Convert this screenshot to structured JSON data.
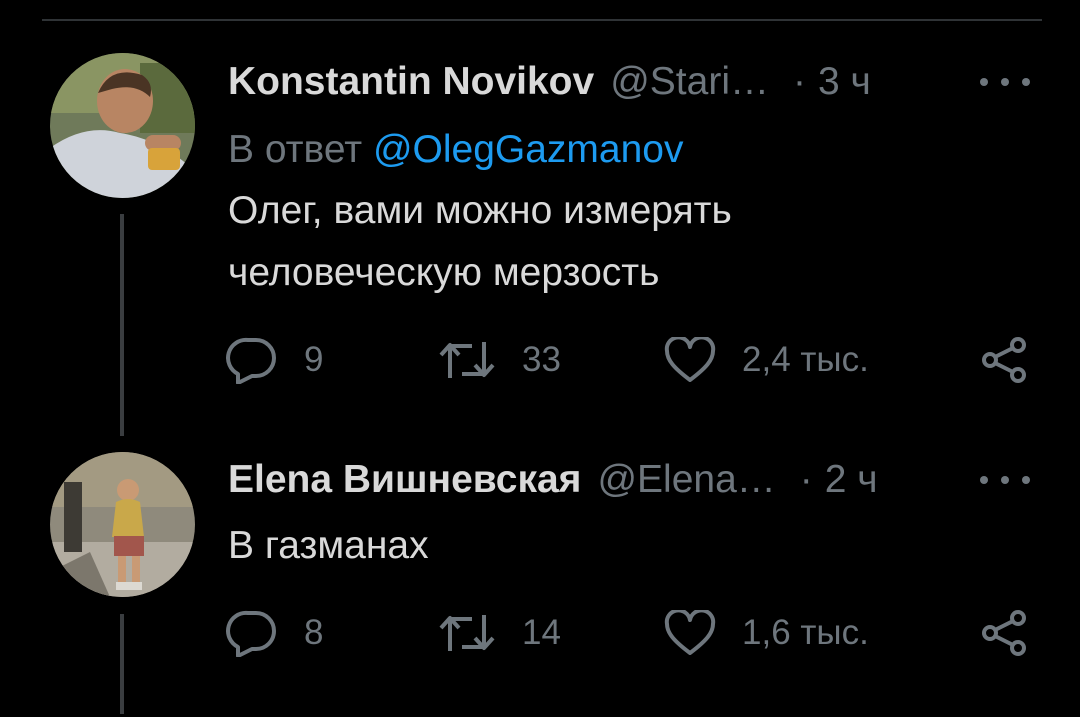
{
  "tweets": [
    {
      "author_name": "Konstantin Novikov",
      "handle": "@Stari…",
      "separator": "·",
      "time": "3 ч",
      "reply_prefix": "В ответ",
      "reply_mention": "@OlegGazmanov",
      "text": "Олег, вами можно измерять\nчеловеческую мерзость",
      "replies": "9",
      "retweets": "33",
      "likes": "2,4 тыс."
    },
    {
      "author_name": "Elena Вишневская",
      "handle": "@Elena…",
      "separator": "·",
      "time": "2 ч",
      "text": "В газманах",
      "replies": "8",
      "retweets": "14",
      "likes": "1,6 тыс."
    }
  ],
  "colors": {
    "background": "#000000",
    "primary_text": "#d9d9d9",
    "secondary_text": "#6e767d",
    "accent": "#1d9bf0"
  },
  "icons": [
    "reply-icon",
    "retweet-icon",
    "like-icon",
    "share-icon",
    "more-icon"
  ]
}
